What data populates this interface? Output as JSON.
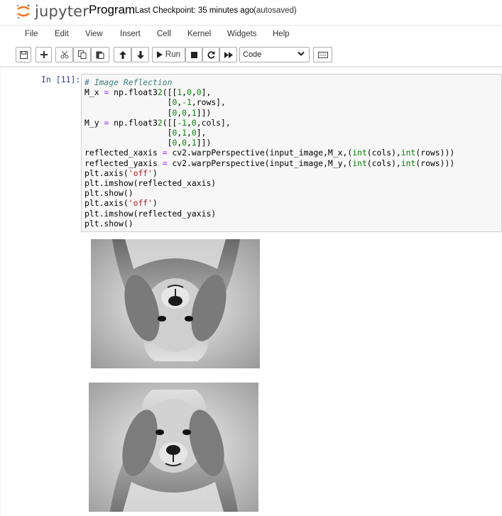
{
  "header": {
    "logo_text": "jupyter",
    "notebook_title": "Program",
    "checkpoint": "Last Checkpoint: 35 minutes ago",
    "autosaved": "(autosaved)"
  },
  "menu": {
    "file": "File",
    "edit": "Edit",
    "view": "View",
    "insert": "Insert",
    "cell": "Cell",
    "kernel": "Kernel",
    "widgets": "Widgets",
    "help": "Help"
  },
  "toolbar": {
    "run_label": "Run",
    "cell_type": "Code",
    "icons": [
      "save-icon",
      "plus-icon",
      "cut-icon",
      "copy-icon",
      "paste-icon",
      "arrow-up-icon",
      "arrow-down-icon",
      "play-icon",
      "stop-icon",
      "restart-icon",
      "fast-forward-icon",
      "chevron-down-icon",
      "keyboard-icon"
    ]
  },
  "cell": {
    "prompt": "In [11]:",
    "code_lines": [
      "# Image Reflection",
      "M_x = np.float32([[1,0,0],",
      "                 [0,-1,rows],",
      "                 [0,0,1]])",
      "M_y = np.float32([[-1,0,cols],",
      "                 [0,1,0],",
      "                 [0,0,1]])",
      "reflected_xaxis = cv2.warpPerspective(input_image,M_x,(int(cols),int(rows)))",
      "reflected_yaxis = cv2.warpPerspective(input_image,M_y,(int(cols),int(rows)))",
      "plt.axis('off')",
      "plt.imshow(reflected_xaxis)",
      "plt.show()",
      "plt.axis('off')",
      "plt.imshow(reflected_yaxis)",
      "plt.show()"
    ]
  },
  "outputs": [
    {
      "content": "grayscale golden retriever drawing, flipped vertically"
    },
    {
      "content": "grayscale golden retriever drawing, upright"
    }
  ],
  "colors": {
    "logo_orange": "#f37726",
    "prompt_blue": "#303f9f",
    "cell_bg": "#f7f7f7",
    "comment": "#408080",
    "string": "#ba2121",
    "builtin": "#008000"
  }
}
